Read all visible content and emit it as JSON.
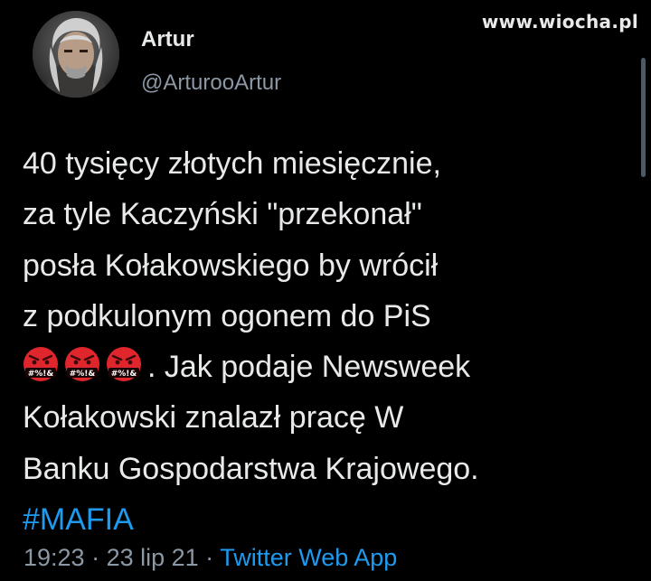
{
  "watermark": "www.wiocha.pl",
  "author": {
    "display_name": "Artur",
    "handle": "@ArturooArtur"
  },
  "tweet": {
    "lines": [
      "40 tysięcy złotych miesięcznie,",
      "za tyle Kaczyński \"przekonał\"",
      "posła Kołakowskiego by wrócił",
      "z podkulonym ogonem do PiS"
    ],
    "emoji_label": "#%!&",
    "emoji_name": "face-with-symbols-on-mouth-icon",
    "line5_rest": ". Jak podaje Newsweek",
    "line6": "Kołakowski znalazł pracę W",
    "line7": "Banku Gospodarstwa Krajowego.",
    "hashtag": "#MAFIA"
  },
  "meta": {
    "time": "19:23",
    "sep1": " · ",
    "date": "23 lip 21",
    "sep2": " · ",
    "source": "Twitter Web App"
  },
  "colors": {
    "background": "#000000",
    "text": "#e7e9ea",
    "secondary": "#8b98a5",
    "accent": "#1d9bf0",
    "emoji_red": "#e0262d"
  }
}
